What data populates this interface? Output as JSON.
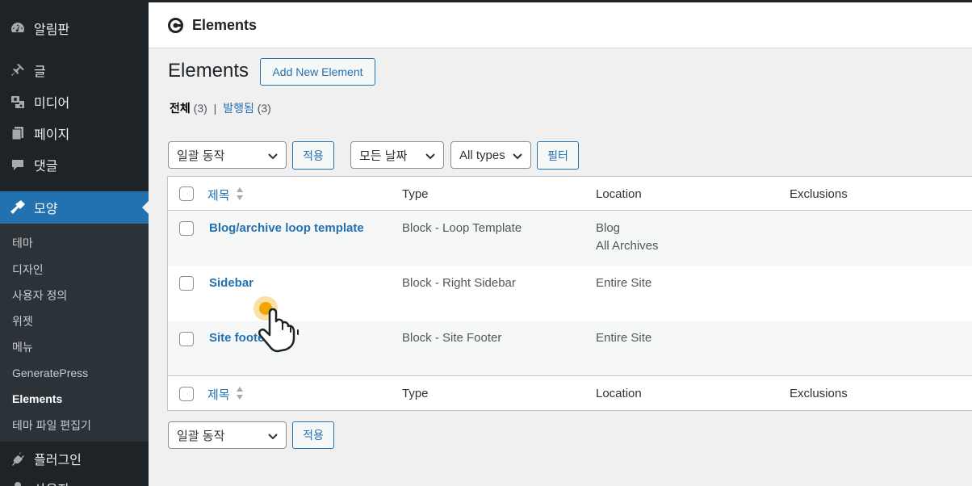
{
  "sidebar": {
    "top_items": [
      {
        "label": "알림판",
        "icon": "dashboard-icon"
      },
      {
        "label": "글",
        "icon": "pin-icon"
      },
      {
        "label": "미디어",
        "icon": "media-icon"
      },
      {
        "label": "페이지",
        "icon": "pages-icon"
      },
      {
        "label": "댓글",
        "icon": "comments-icon"
      },
      {
        "label": "모양",
        "icon": "appearance-icon"
      },
      {
        "label": "플러그인",
        "icon": "plugins-icon"
      },
      {
        "label": "사용자",
        "icon": "users-icon"
      }
    ],
    "submenu": [
      "테마",
      "디자인",
      "사용자 정의",
      "위젯",
      "메뉴",
      "GeneratePress",
      "Elements",
      "테마 파일 편집기"
    ]
  },
  "header": {
    "title": "Elements",
    "icon": "generatepress-logo-icon"
  },
  "page": {
    "title": "Elements",
    "add_new": "Add New Element"
  },
  "views": {
    "all_label": "전체",
    "all_count": "(3)",
    "sep": "|",
    "published_label": "발행됨",
    "published_count": "(3)"
  },
  "filters": {
    "bulk_action": "일괄 동작",
    "apply": "적용",
    "dates": "모든 날짜",
    "types": "All types",
    "filter_btn": "필터"
  },
  "table": {
    "columns": [
      "제목",
      "Type",
      "Location",
      "Exclusions"
    ],
    "rows": [
      {
        "title": "Blog/archive loop template",
        "type": "Block - Loop Template",
        "location": [
          "Blog",
          "All Archives"
        ]
      },
      {
        "title": "Sidebar",
        "type": "Block - Right Sidebar",
        "location": [
          "Entire Site"
        ]
      },
      {
        "title": "Site footer",
        "type": "Block - Site Footer",
        "location": [
          "Entire Site"
        ]
      }
    ]
  },
  "colors": {
    "accent": "#2271b1",
    "sidebar_bg": "#1d2327",
    "cursor_dot": "#f0a500"
  }
}
